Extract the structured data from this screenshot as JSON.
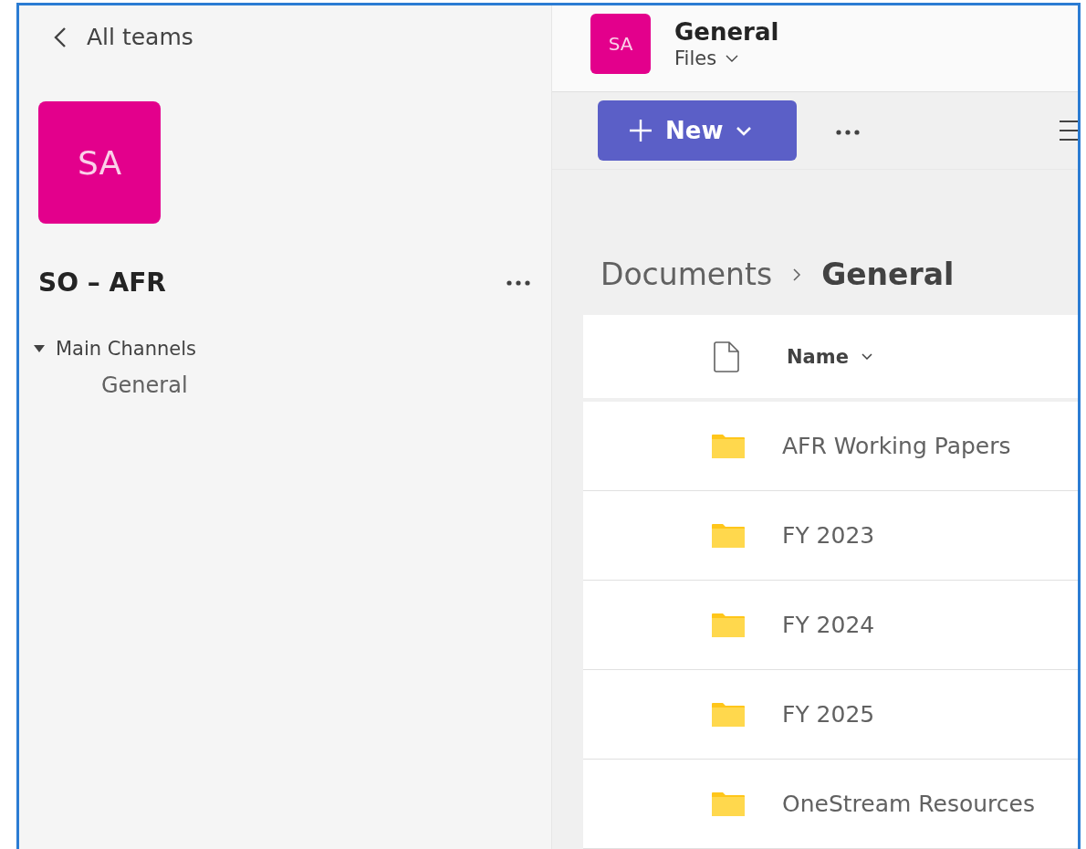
{
  "sidebar": {
    "back_link": "All teams",
    "team_avatar": "SA",
    "team_name": "SO – AFR",
    "channel_groups": [
      {
        "name": "Main Channels",
        "expanded": true,
        "children": [
          {
            "label": "General",
            "selected": false
          }
        ]
      }
    ]
  },
  "channel_header": {
    "avatar": "SA",
    "title": "General",
    "tab": "Files"
  },
  "toolbar": {
    "new_button": "New"
  },
  "breadcrumb": [
    "Documents",
    "General"
  ],
  "file_table": {
    "columns": [
      "Name"
    ],
    "rows": [
      {
        "name": "AFR Working Papers",
        "kind": "folder"
      },
      {
        "name": "FY 2023",
        "kind": "folder"
      },
      {
        "name": "FY 2024",
        "kind": "folder"
      },
      {
        "name": "FY 2025",
        "kind": "folder"
      },
      {
        "name": "OneStream Resources",
        "kind": "folder"
      }
    ]
  }
}
